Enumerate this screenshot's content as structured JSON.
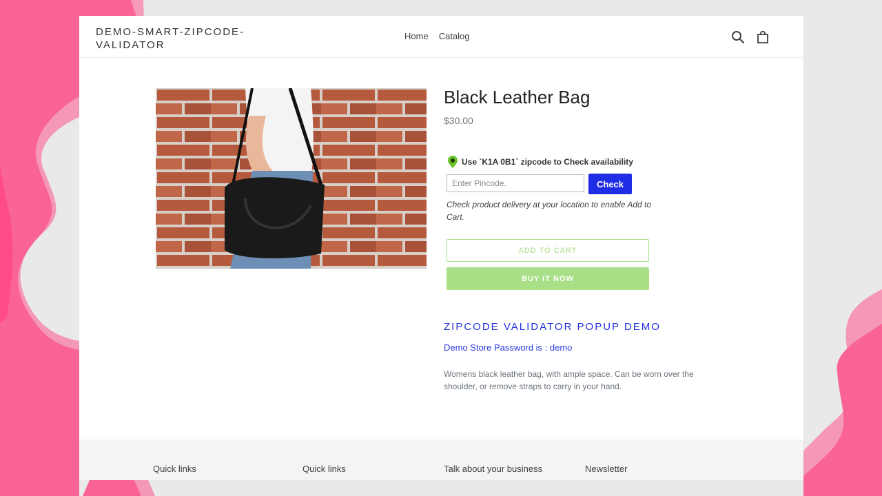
{
  "store": {
    "logo": "DEMO-SMART-ZIPCODE-VALIDATOR"
  },
  "nav": {
    "items": [
      {
        "label": "Home"
      },
      {
        "label": "Catalog"
      }
    ],
    "icons": [
      "search-icon",
      "cart-icon"
    ]
  },
  "product": {
    "image_alt": "Black leather bag carried over shoulder in front of brick wall",
    "title": "Black Leather Bag",
    "price": "$30.00",
    "zip_note": "Use `K1A 0B1` zipcode to Check availability",
    "pincode_input": {
      "value": "",
      "placeholder": "Enter Pincode."
    },
    "check_label": "Check",
    "delivery_note": "Check product delivery at your location to enable Add to Cart.",
    "add_to_cart_label": "ADD TO CART",
    "buy_now_label": "BUY IT NOW",
    "popup_heading": "ZIPCODE VALIDATOR POPUP DEMO",
    "password_text": "Demo Store Password is : demo",
    "description": "Womens black leather bag, with ample space. Can be worn over the shoulder, or remove straps to carry in your hand."
  },
  "footer": {
    "columns": [
      {
        "heading": "Quick links"
      },
      {
        "heading": "Quick links"
      },
      {
        "heading": "Talk about your business"
      },
      {
        "heading": "Newsletter"
      }
    ]
  },
  "colors": {
    "accent_blue": "#1f2de6",
    "button_green": "#a8df87",
    "background_pink": "#f96495"
  }
}
